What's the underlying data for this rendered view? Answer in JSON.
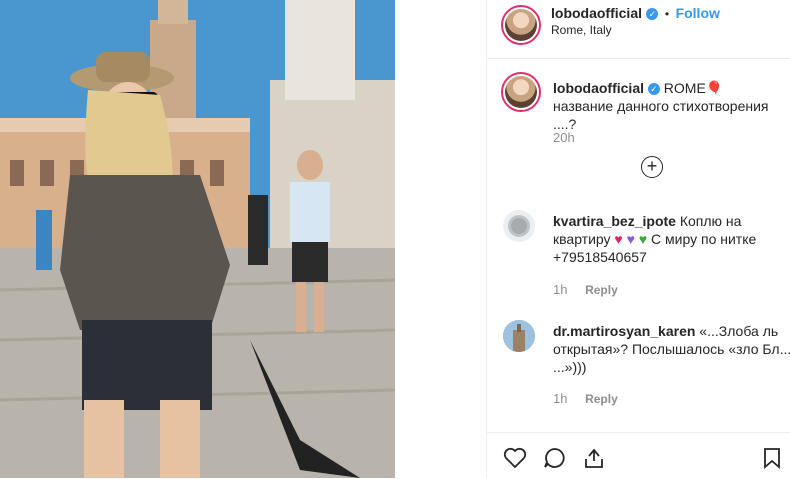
{
  "post": {
    "username": "lobodaofficial",
    "location": "Rome, Italy",
    "follow_label": "Follow",
    "separator": "•"
  },
  "caption": {
    "username": "lobodaofficial",
    "text_line1": "ROME",
    "text_line2": "название данного стихотворения ....?",
    "time": "20h"
  },
  "comments": [
    {
      "username": "kvartira_bez_ipote",
      "text_a": "Коплю на квартиру",
      "text_b": "С миру по нитке +79518540657",
      "time": "1h",
      "reply_label": "Reply"
    },
    {
      "username": "dr.martirosyan_karen",
      "text": "«...Злоба ль открытая»? Послышалось «зло Бл... ...»)))",
      "time": "1h",
      "reply_label": "Reply"
    }
  ],
  "icons": [
    "verified-icon",
    "balloon-icon",
    "load-more-icon",
    "red-heart-icon",
    "purple-heart-icon",
    "green-heart-icon",
    "like-icon",
    "comment-icon",
    "share-icon",
    "save-icon"
  ],
  "colors": {
    "accent": "#3897f0",
    "muted": "#8e8e8e",
    "text": "#262626",
    "ring": "#e1306c"
  }
}
